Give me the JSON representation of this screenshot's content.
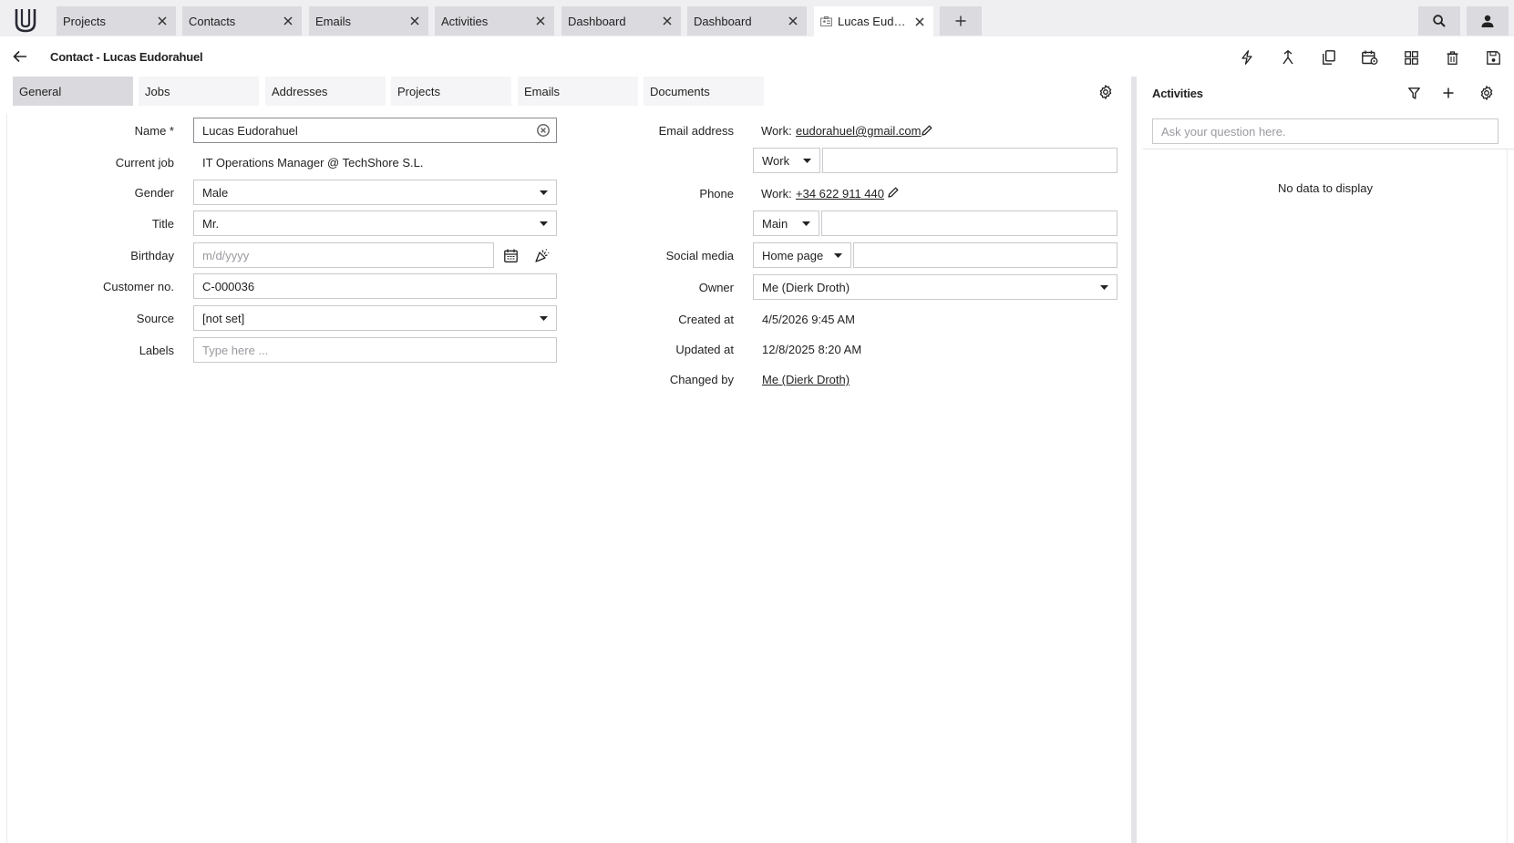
{
  "topbar": {
    "tabs": [
      {
        "label": "Projects"
      },
      {
        "label": "Contacts"
      },
      {
        "label": "Emails"
      },
      {
        "label": "Activities"
      },
      {
        "label": "Dashboard"
      },
      {
        "label": "Dashboard"
      },
      {
        "label": "Lucas Eudora..."
      }
    ],
    "icons": [
      "logo-icon",
      "close-icon",
      "plus-icon",
      "search-icon",
      "user-icon",
      "contact-card-icon"
    ]
  },
  "header": {
    "title": "Contact - Lucas Eudorahuel",
    "actions": [
      "flash-icon",
      "merge-icon",
      "copy-icon",
      "calendar-settings-icon",
      "layout-icon",
      "delete-icon",
      "save-icon"
    ]
  },
  "section_tabs": [
    {
      "label": "General"
    },
    {
      "label": "Jobs"
    },
    {
      "label": "Addresses"
    },
    {
      "label": "Projects"
    },
    {
      "label": "Emails"
    },
    {
      "label": "Documents"
    }
  ],
  "form": {
    "name": {
      "label": "Name *",
      "value": "Lucas Eudorahuel"
    },
    "current_job": {
      "label": "Current job",
      "value": "IT Operations Manager @ TechShore S.L."
    },
    "gender": {
      "label": "Gender",
      "value": "Male"
    },
    "title": {
      "label": "Title",
      "value": "Mr."
    },
    "birthday": {
      "label": "Birthday",
      "placeholder": "m/d/yyyy"
    },
    "customer_no": {
      "label": "Customer no.",
      "value": "C-000036"
    },
    "source": {
      "label": "Source",
      "value": "[not set]"
    },
    "labels": {
      "label": "Labels",
      "placeholder": "Type here ..."
    },
    "email": {
      "label": "Email address",
      "prefix": "Work:",
      "value": "eudorahuel@gmail.com",
      "type_select": "Work"
    },
    "phone": {
      "label": "Phone",
      "prefix": "Work:",
      "value": "+34 622 911 440",
      "type_select": "Main"
    },
    "social": {
      "label": "Social media",
      "type_select": "Home page"
    },
    "owner": {
      "label": "Owner",
      "value": "Me (Dierk Droth)"
    },
    "created_at": {
      "label": "Created at",
      "value": "4/5/2026 9:45 AM"
    },
    "updated_at": {
      "label": "Updated at",
      "value": "12/8/2025 8:20 AM"
    },
    "changed_by": {
      "label": "Changed by",
      "value": "Me (Dierk Droth)"
    }
  },
  "activities": {
    "title": "Activities",
    "search_placeholder": "Ask your question here.",
    "empty": "No data to display"
  }
}
